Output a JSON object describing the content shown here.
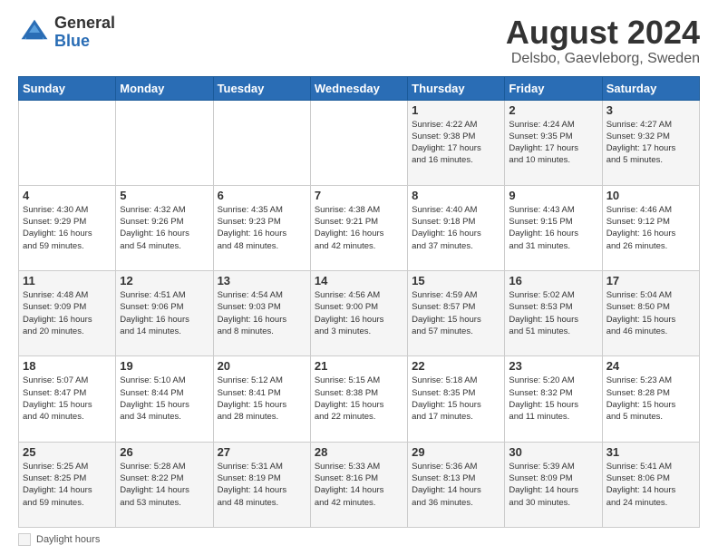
{
  "header": {
    "logo_general": "General",
    "logo_blue": "Blue",
    "title": "August 2024",
    "subtitle": "Delsbo, Gaevleborg, Sweden"
  },
  "weekdays": [
    "Sunday",
    "Monday",
    "Tuesday",
    "Wednesday",
    "Thursday",
    "Friday",
    "Saturday"
  ],
  "footer": {
    "label": "Daylight hours"
  },
  "weeks": [
    [
      {
        "day": "",
        "info": ""
      },
      {
        "day": "",
        "info": ""
      },
      {
        "day": "",
        "info": ""
      },
      {
        "day": "",
        "info": ""
      },
      {
        "day": "1",
        "info": "Sunrise: 4:22 AM\nSunset: 9:38 PM\nDaylight: 17 hours\nand 16 minutes."
      },
      {
        "day": "2",
        "info": "Sunrise: 4:24 AM\nSunset: 9:35 PM\nDaylight: 17 hours\nand 10 minutes."
      },
      {
        "day": "3",
        "info": "Sunrise: 4:27 AM\nSunset: 9:32 PM\nDaylight: 17 hours\nand 5 minutes."
      }
    ],
    [
      {
        "day": "4",
        "info": "Sunrise: 4:30 AM\nSunset: 9:29 PM\nDaylight: 16 hours\nand 59 minutes."
      },
      {
        "day": "5",
        "info": "Sunrise: 4:32 AM\nSunset: 9:26 PM\nDaylight: 16 hours\nand 54 minutes."
      },
      {
        "day": "6",
        "info": "Sunrise: 4:35 AM\nSunset: 9:23 PM\nDaylight: 16 hours\nand 48 minutes."
      },
      {
        "day": "7",
        "info": "Sunrise: 4:38 AM\nSunset: 9:21 PM\nDaylight: 16 hours\nand 42 minutes."
      },
      {
        "day": "8",
        "info": "Sunrise: 4:40 AM\nSunset: 9:18 PM\nDaylight: 16 hours\nand 37 minutes."
      },
      {
        "day": "9",
        "info": "Sunrise: 4:43 AM\nSunset: 9:15 PM\nDaylight: 16 hours\nand 31 minutes."
      },
      {
        "day": "10",
        "info": "Sunrise: 4:46 AM\nSunset: 9:12 PM\nDaylight: 16 hours\nand 26 minutes."
      }
    ],
    [
      {
        "day": "11",
        "info": "Sunrise: 4:48 AM\nSunset: 9:09 PM\nDaylight: 16 hours\nand 20 minutes."
      },
      {
        "day": "12",
        "info": "Sunrise: 4:51 AM\nSunset: 9:06 PM\nDaylight: 16 hours\nand 14 minutes."
      },
      {
        "day": "13",
        "info": "Sunrise: 4:54 AM\nSunset: 9:03 PM\nDaylight: 16 hours\nand 8 minutes."
      },
      {
        "day": "14",
        "info": "Sunrise: 4:56 AM\nSunset: 9:00 PM\nDaylight: 16 hours\nand 3 minutes."
      },
      {
        "day": "15",
        "info": "Sunrise: 4:59 AM\nSunset: 8:57 PM\nDaylight: 15 hours\nand 57 minutes."
      },
      {
        "day": "16",
        "info": "Sunrise: 5:02 AM\nSunset: 8:53 PM\nDaylight: 15 hours\nand 51 minutes."
      },
      {
        "day": "17",
        "info": "Sunrise: 5:04 AM\nSunset: 8:50 PM\nDaylight: 15 hours\nand 46 minutes."
      }
    ],
    [
      {
        "day": "18",
        "info": "Sunrise: 5:07 AM\nSunset: 8:47 PM\nDaylight: 15 hours\nand 40 minutes."
      },
      {
        "day": "19",
        "info": "Sunrise: 5:10 AM\nSunset: 8:44 PM\nDaylight: 15 hours\nand 34 minutes."
      },
      {
        "day": "20",
        "info": "Sunrise: 5:12 AM\nSunset: 8:41 PM\nDaylight: 15 hours\nand 28 minutes."
      },
      {
        "day": "21",
        "info": "Sunrise: 5:15 AM\nSunset: 8:38 PM\nDaylight: 15 hours\nand 22 minutes."
      },
      {
        "day": "22",
        "info": "Sunrise: 5:18 AM\nSunset: 8:35 PM\nDaylight: 15 hours\nand 17 minutes."
      },
      {
        "day": "23",
        "info": "Sunrise: 5:20 AM\nSunset: 8:32 PM\nDaylight: 15 hours\nand 11 minutes."
      },
      {
        "day": "24",
        "info": "Sunrise: 5:23 AM\nSunset: 8:28 PM\nDaylight: 15 hours\nand 5 minutes."
      }
    ],
    [
      {
        "day": "25",
        "info": "Sunrise: 5:25 AM\nSunset: 8:25 PM\nDaylight: 14 hours\nand 59 minutes."
      },
      {
        "day": "26",
        "info": "Sunrise: 5:28 AM\nSunset: 8:22 PM\nDaylight: 14 hours\nand 53 minutes."
      },
      {
        "day": "27",
        "info": "Sunrise: 5:31 AM\nSunset: 8:19 PM\nDaylight: 14 hours\nand 48 minutes."
      },
      {
        "day": "28",
        "info": "Sunrise: 5:33 AM\nSunset: 8:16 PM\nDaylight: 14 hours\nand 42 minutes."
      },
      {
        "day": "29",
        "info": "Sunrise: 5:36 AM\nSunset: 8:13 PM\nDaylight: 14 hours\nand 36 minutes."
      },
      {
        "day": "30",
        "info": "Sunrise: 5:39 AM\nSunset: 8:09 PM\nDaylight: 14 hours\nand 30 minutes."
      },
      {
        "day": "31",
        "info": "Sunrise: 5:41 AM\nSunset: 8:06 PM\nDaylight: 14 hours\nand 24 minutes."
      }
    ]
  ]
}
